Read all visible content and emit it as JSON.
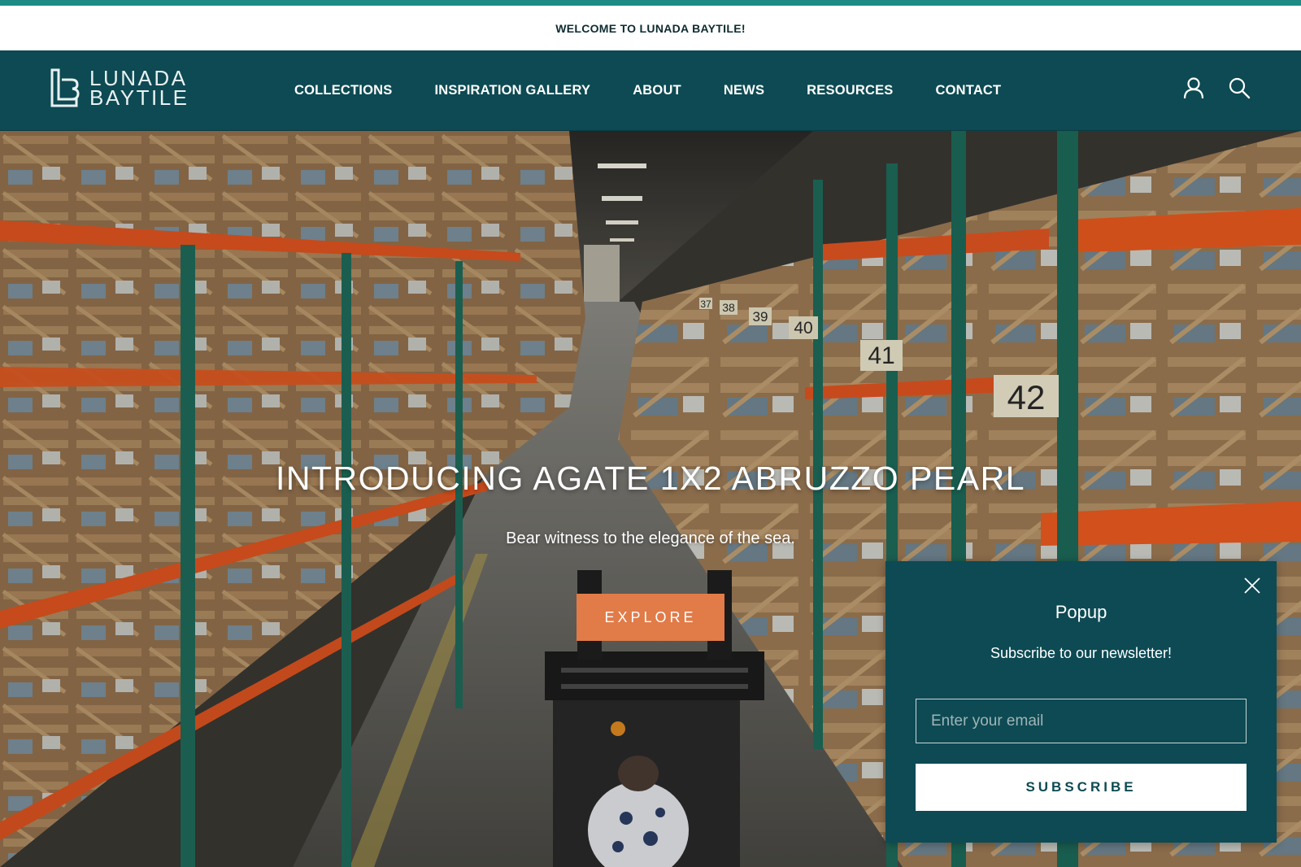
{
  "announcement": {
    "text": "WELCOME TO LUNADA BAYTILE!"
  },
  "brand": {
    "line1": "LUNADA",
    "line2": "BAYTILE",
    "accent_color": "#1e8a86",
    "header_color": "#0d4a53"
  },
  "nav": {
    "items": [
      {
        "label": "COLLECTIONS"
      },
      {
        "label": "INSPIRATION GALLERY"
      },
      {
        "label": "ABOUT"
      },
      {
        "label": "NEWS"
      },
      {
        "label": "RESOURCES"
      },
      {
        "label": "CONTACT"
      }
    ],
    "icons": [
      "account-icon",
      "search-icon"
    ]
  },
  "hero": {
    "title": "INTRODUCING AGATE 1X2 ABRUZZO PEARL",
    "subtitle": "Bear witness to the elegance of the sea.",
    "cta_label": "EXPLORE",
    "cta_color": "#e17b48",
    "aisle_labels": [
      "37",
      "38",
      "39",
      "40",
      "41",
      "42"
    ]
  },
  "popup": {
    "title": "Popup",
    "text": "Subscribe to our newsletter!",
    "email_placeholder": "Enter your email",
    "subscribe_label": "SUBSCRIBE"
  }
}
